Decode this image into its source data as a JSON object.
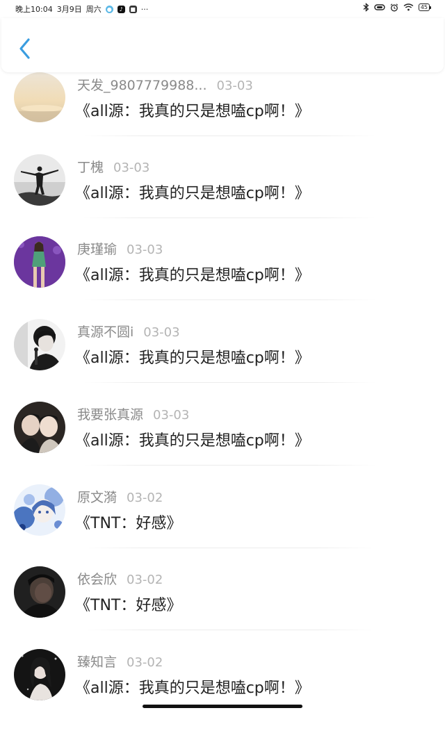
{
  "status_bar": {
    "time": "晚上10:04",
    "date": "3月9日",
    "weekday": "周六",
    "more": "···",
    "battery": "45"
  },
  "header": {
    "back_icon": "chevron-left-icon",
    "accent_color": "#3a9de0"
  },
  "list": [
    {
      "name": "天发_9807779988...",
      "date": "03-03",
      "title": "《all源：我真的只是想嗑cp啊！》",
      "avatar": "sunset"
    },
    {
      "name": "丁槐",
      "date": "03-03",
      "title": "《all源：我真的只是想嗑cp啊！》",
      "avatar": "silhouette"
    },
    {
      "name": "庚瑾瑜",
      "date": "03-03",
      "title": "《all源：我真的只是想嗑cp啊！》",
      "avatar": "purple-portrait"
    },
    {
      "name": "真源不圆i",
      "date": "03-03",
      "title": "《all源：我真的只是想嗑cp啊！》",
      "avatar": "bw-portrait"
    },
    {
      "name": "我要张真源",
      "date": "03-03",
      "title": "《all源：我真的只是想嗑cp啊！》",
      "avatar": "two-people"
    },
    {
      "name": "原文漪",
      "date": "03-02",
      "title": "《TNT：好感》",
      "avatar": "anime-blue"
    },
    {
      "name": "依会欣",
      "date": "03-02",
      "title": "《TNT：好感》",
      "avatar": "dark-portrait"
    },
    {
      "name": "臻知言",
      "date": "03-02",
      "title": "《all源：我真的只是想嗑cp啊！》",
      "avatar": "dark-girl"
    }
  ]
}
